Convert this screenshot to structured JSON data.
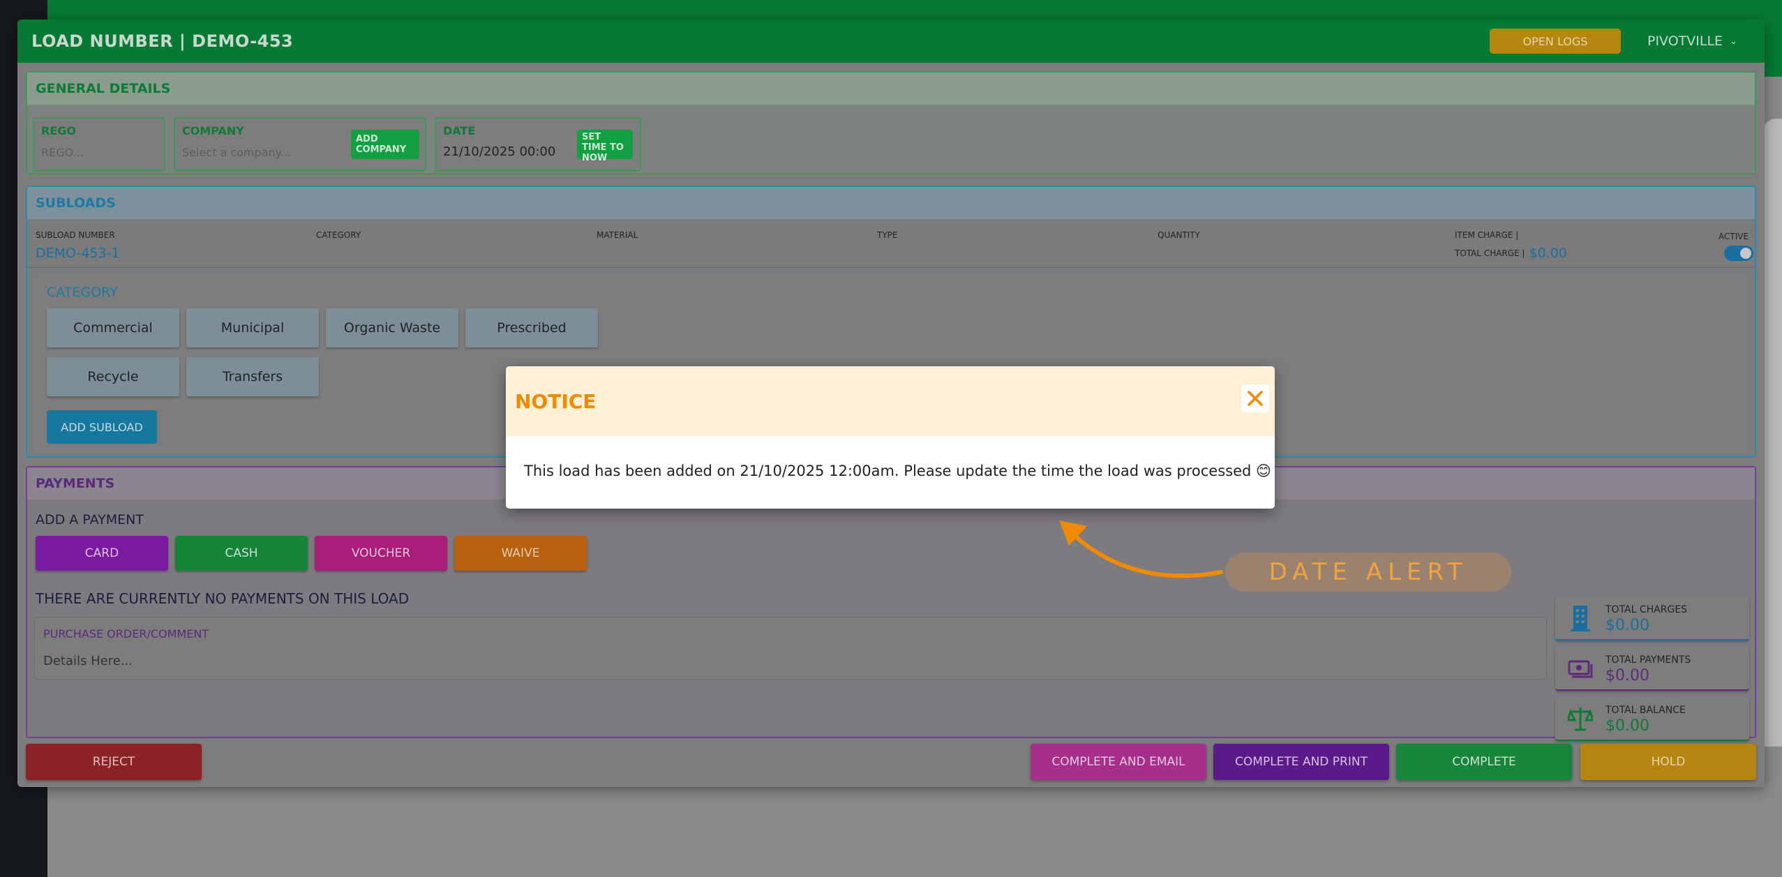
{
  "header": {
    "title": "LOAD NUMBER | DEMO-453",
    "open_logs_label": "OPEN LOGS",
    "user": "PIVOTVILLE"
  },
  "general": {
    "title": "GENERAL DETAILS",
    "rego_label": "REGO",
    "rego_placeholder": "REGO...",
    "company_label": "COMPANY",
    "company_placeholder": "Select a company...",
    "add_company_label": "ADD COMPANY",
    "date_label": "DATE",
    "date_value": "21/10/2025 00:00",
    "set_time_label": "SET TIME TO NOW"
  },
  "subloads": {
    "title": "SUBLOADS",
    "columns": [
      "SUBLOAD NUMBER",
      "CATEGORY",
      "MATERIAL",
      "TYPE",
      "QUANTITY",
      "ITEM CHARGE |",
      "ACTIVE"
    ],
    "row": {
      "number": "DEMO-453-1",
      "total_charge_label": "TOTAL CHARGE |",
      "total_charge": "$0.00"
    },
    "category_title": "CATEGORY",
    "categories": [
      "Commercial",
      "Municipal",
      "Organic Waste",
      "Prescribed",
      "Recycle",
      "Transfers"
    ],
    "add_subload_label": "ADD SUBLOAD"
  },
  "payments": {
    "title": "PAYMENTS",
    "add_payment_label": "ADD A PAYMENT",
    "buttons": [
      "CARD",
      "CASH",
      "VOUCHER",
      "WAIVE"
    ],
    "no_payments": "THERE ARE CURRENTLY NO PAYMENTS ON THIS LOAD",
    "po_label": "PURCHASE ORDER/COMMENT",
    "po_placeholder": "Details Here...",
    "totals": [
      {
        "label": "TOTAL CHARGES",
        "value": "$0.00",
        "color": "#1a6ea0"
      },
      {
        "label": "TOTAL PAYMENTS",
        "value": "$0.00",
        "color": "#5b2a7a"
      },
      {
        "label": "TOTAL BALANCE",
        "value": "$0.00",
        "color": "#0f7a36"
      }
    ]
  },
  "actions": {
    "reject": "REJECT",
    "complete_email": "COMPLETE AND EMAIL",
    "complete_print": "COMPLETE AND PRINT",
    "complete": "COMPLETE",
    "hold": "HOLD"
  },
  "modal": {
    "title": "NOTICE",
    "message": "This load has been added on 21/10/2025 12:00am. Please update the time the load was processed 😊"
  },
  "annotation": {
    "label": "DATE ALERT"
  },
  "colors": {
    "brand_green": "#067a34",
    "accent_orange": "#f08a00",
    "subload_blue": "#1a6ea0",
    "payments_purple": "#5b2a7a"
  }
}
